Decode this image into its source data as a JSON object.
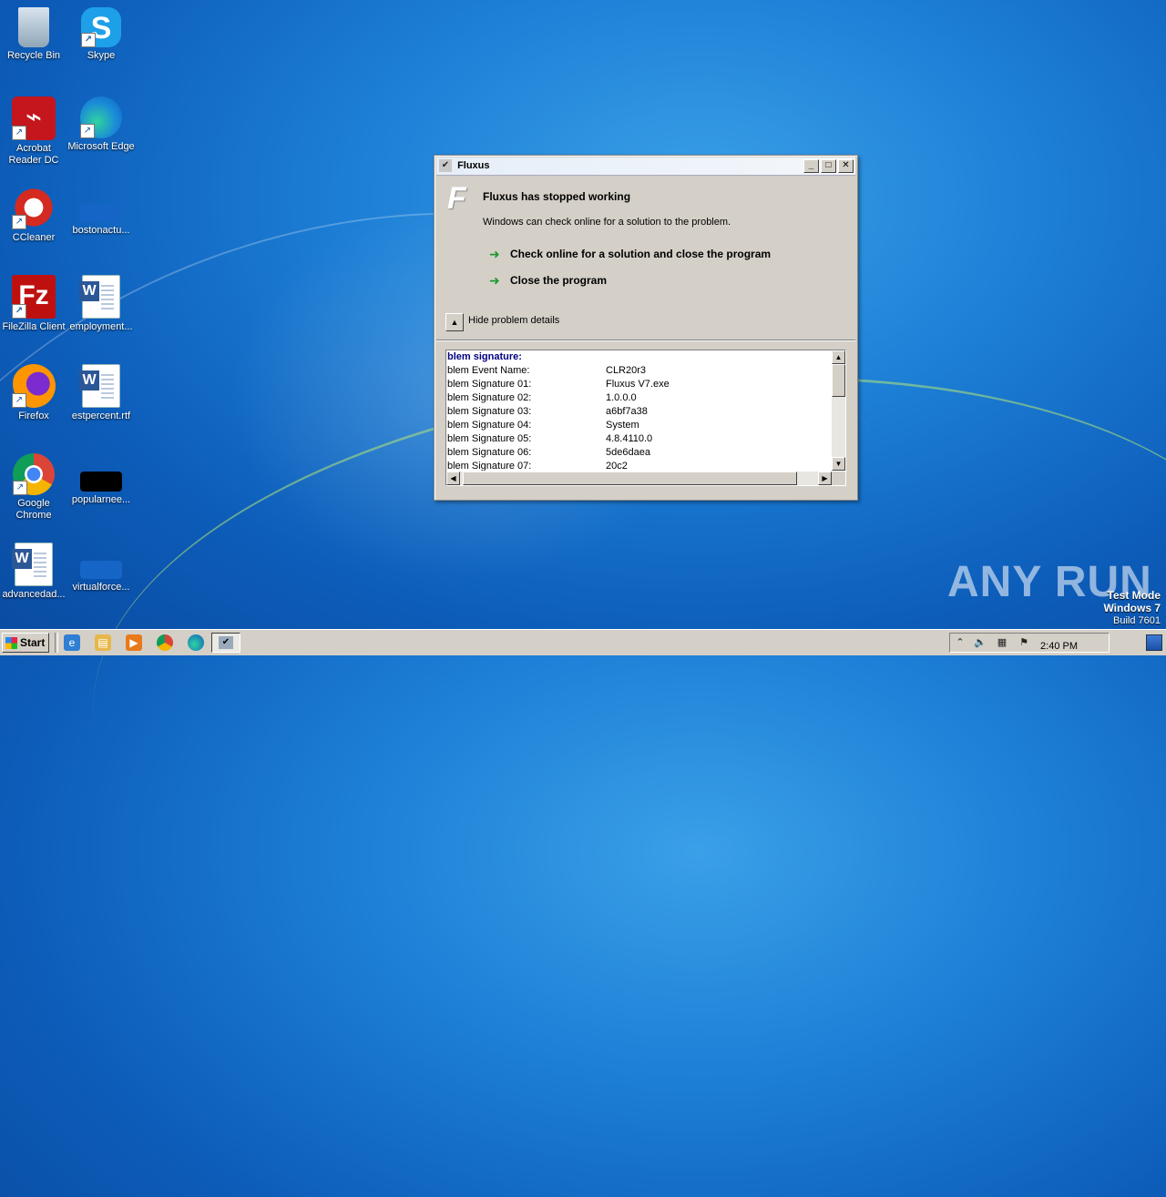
{
  "desktop": {
    "icons": [
      {
        "label": "Recycle Bin",
        "icon": "recycle-bin-icon"
      },
      {
        "label": "Skype",
        "icon": "skype-icon"
      },
      {
        "label": "Acrobat Reader DC",
        "icon": "acrobat-icon"
      },
      {
        "label": "Microsoft Edge",
        "icon": "edge-icon"
      },
      {
        "label": "CCleaner",
        "icon": "ccleaner-icon"
      },
      {
        "label": "bostonactu...",
        "icon": "file-icon"
      },
      {
        "label": "FileZilla Client",
        "icon": "filezilla-icon"
      },
      {
        "label": "employment...",
        "icon": "word-doc-icon"
      },
      {
        "label": "Firefox",
        "icon": "firefox-icon"
      },
      {
        "label": "estpercent.rtf",
        "icon": "word-doc-icon"
      },
      {
        "label": "Google Chrome",
        "icon": "chrome-icon"
      },
      {
        "label": "popularnee...",
        "icon": "file-icon"
      },
      {
        "label": "advancedad...",
        "icon": "word-doc-icon"
      },
      {
        "label": "virtualforce...",
        "icon": "file-icon"
      }
    ]
  },
  "dialog": {
    "title": "Fluxus",
    "heading": "Fluxus has stopped working",
    "subtext": "Windows can check online for a solution to the problem.",
    "action_check": "Check online for a solution and close the program",
    "action_close": "Close the program",
    "hide_details": "Hide problem details",
    "details_header": "blem signature:",
    "details": [
      {
        "key": "blem Event Name:",
        "value": "CLR20r3"
      },
      {
        "key": "blem Signature 01:",
        "value": "Fluxus V7.exe"
      },
      {
        "key": "blem Signature 02:",
        "value": "1.0.0.0"
      },
      {
        "key": "blem Signature 03:",
        "value": "a6bf7a38"
      },
      {
        "key": "blem Signature 04:",
        "value": "System"
      },
      {
        "key": "blem Signature 05:",
        "value": "4.8.4110.0"
      },
      {
        "key": "blem Signature 06:",
        "value": "5de6daea"
      },
      {
        "key": "blem Signature 07:",
        "value": "20c2"
      }
    ]
  },
  "watermark": "ANY RUN",
  "test_mode": {
    "line1": "Test Mode",
    "line2": "Windows 7",
    "line3": "Build 7601"
  },
  "taskbar": {
    "start_label": "Start",
    "clock": "2:40 PM"
  }
}
